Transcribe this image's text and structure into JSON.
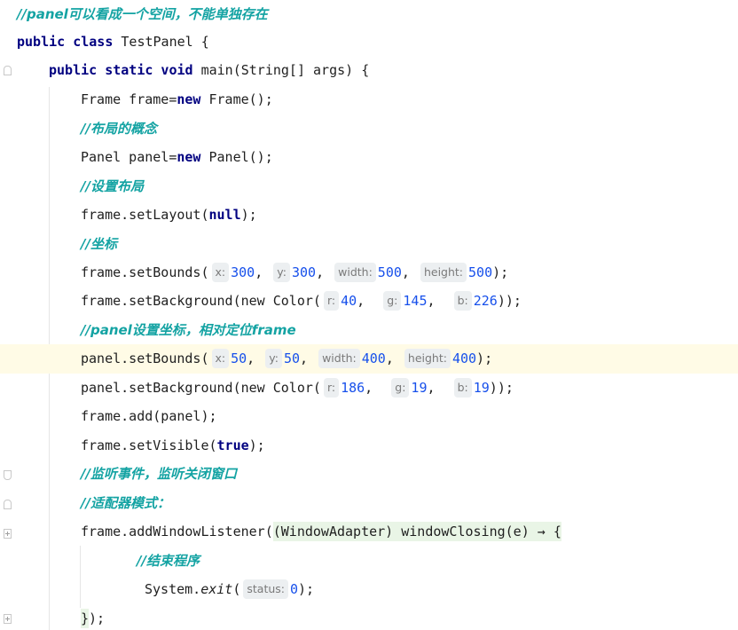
{
  "editor": {
    "lines": [
      {
        "segments": [
          {
            "t": "cmt",
            "v": "//panel可以看成一个空间，不能单独存在"
          }
        ]
      },
      {
        "segments": [
          {
            "t": "kw",
            "v": "public class "
          },
          {
            "t": "plain",
            "v": "TestPanel {"
          }
        ]
      },
      {
        "segments": [
          {
            "t": "kw",
            "v": "public static void "
          },
          {
            "t": "plain",
            "v": "main(String[] args) {"
          }
        ]
      },
      {
        "segments": [
          {
            "t": "plain",
            "v": "Frame frame="
          },
          {
            "t": "kw",
            "v": "new "
          },
          {
            "t": "plain",
            "v": "Frame();"
          }
        ]
      },
      {
        "segments": [
          {
            "t": "cmt",
            "v": "//布局的概念"
          }
        ]
      },
      {
        "segments": [
          {
            "t": "plain",
            "v": "Panel panel="
          },
          {
            "t": "kw",
            "v": "new "
          },
          {
            "t": "plain",
            "v": "Panel();"
          }
        ]
      },
      {
        "segments": [
          {
            "t": "cmt",
            "v": "//设置布局"
          }
        ]
      },
      {
        "segments": [
          {
            "t": "plain",
            "v": "frame.setLayout("
          },
          {
            "t": "kw",
            "v": "null"
          },
          {
            "t": "plain",
            "v": ");"
          }
        ]
      },
      {
        "segments": [
          {
            "t": "cmt",
            "v": "//坐标"
          }
        ]
      },
      {
        "segments": [
          {
            "t": "plain",
            "v": "frame.setBounds("
          },
          {
            "t": "hint",
            "v": "x:"
          },
          {
            "t": "num",
            "v": "300"
          },
          {
            "t": "plain",
            "v": ", "
          },
          {
            "t": "hint",
            "v": "y:"
          },
          {
            "t": "num",
            "v": "300"
          },
          {
            "t": "plain",
            "v": ", "
          },
          {
            "t": "hint",
            "v": "width:"
          },
          {
            "t": "num",
            "v": "500"
          },
          {
            "t": "plain",
            "v": ", "
          },
          {
            "t": "hint",
            "v": "height:"
          },
          {
            "t": "num",
            "v": "500"
          },
          {
            "t": "plain",
            "v": ");"
          }
        ]
      },
      {
        "segments": [
          {
            "t": "plain",
            "v": "frame.setBackground("
          },
          {
            "t": "kw-plain",
            "v": "new "
          },
          {
            "t": "plain",
            "v": "Color("
          },
          {
            "t": "hint",
            "v": "r:"
          },
          {
            "t": "num",
            "v": "40"
          },
          {
            "t": "plain",
            "v": ",  "
          },
          {
            "t": "hint",
            "v": "g:"
          },
          {
            "t": "num",
            "v": "145"
          },
          {
            "t": "plain",
            "v": ",  "
          },
          {
            "t": "hint",
            "v": "b:"
          },
          {
            "t": "num",
            "v": "226"
          },
          {
            "t": "plain",
            "v": "));"
          }
        ]
      },
      {
        "segments": [
          {
            "t": "cmt",
            "v": "//panel设置坐标，相对定位frame"
          }
        ]
      },
      {
        "segments": [
          {
            "t": "plain",
            "v": "panel.setBounds("
          },
          {
            "t": "hint",
            "v": "x:"
          },
          {
            "t": "num",
            "v": "50"
          },
          {
            "t": "plain",
            "v": ", "
          },
          {
            "t": "hint",
            "v": "y:"
          },
          {
            "t": "num",
            "v": "50"
          },
          {
            "t": "plain",
            "v": ", "
          },
          {
            "t": "hint",
            "v": "width:"
          },
          {
            "t": "num",
            "v": "400"
          },
          {
            "t": "plain",
            "v": ", "
          },
          {
            "t": "hint",
            "v": "height:"
          },
          {
            "t": "num",
            "v": "400"
          },
          {
            "t": "plain",
            "v": ");"
          }
        ]
      },
      {
        "segments": [
          {
            "t": "plain",
            "v": "panel.setBackground("
          },
          {
            "t": "kw-plain",
            "v": "new "
          },
          {
            "t": "plain",
            "v": "Color("
          },
          {
            "t": "hint",
            "v": "r:"
          },
          {
            "t": "num",
            "v": "186"
          },
          {
            "t": "plain",
            "v": ",  "
          },
          {
            "t": "hint",
            "v": "g:"
          },
          {
            "t": "num",
            "v": "19"
          },
          {
            "t": "plain",
            "v": ",  "
          },
          {
            "t": "hint",
            "v": "b:"
          },
          {
            "t": "num",
            "v": "19"
          },
          {
            "t": "plain",
            "v": "));"
          }
        ]
      },
      {
        "segments": [
          {
            "t": "plain",
            "v": "frame.add(panel);"
          }
        ]
      },
      {
        "segments": [
          {
            "t": "plain",
            "v": "frame.setVisible("
          },
          {
            "t": "kw",
            "v": "true"
          },
          {
            "t": "plain",
            "v": ");"
          }
        ]
      },
      {
        "segments": [
          {
            "t": "cmt",
            "v": "//监听事件，监听关闭窗口"
          }
        ]
      },
      {
        "segments": [
          {
            "t": "cmt",
            "v": "//适配器模式："
          }
        ]
      },
      {
        "segments": [
          {
            "t": "plain",
            "v": "frame.addWindowListener("
          },
          {
            "t": "lambda",
            "v": "(WindowAdapter) windowClosing(e) → {"
          }
        ]
      },
      {
        "segments": [
          {
            "t": "cmt",
            "v": "//结束程序"
          }
        ]
      },
      {
        "segments": [
          {
            "t": "plain",
            "v": "System."
          },
          {
            "t": "ital",
            "v": "exit"
          },
          {
            "t": "plain",
            "v": "("
          },
          {
            "t": "hint",
            "v": "status:"
          },
          {
            "t": "num",
            "v": "0"
          },
          {
            "t": "plain",
            "v": ");"
          }
        ]
      },
      {
        "segments": [
          {
            "t": "lambda",
            "v": "}"
          },
          {
            "t": "plain",
            "v": ");"
          }
        ]
      }
    ],
    "colors": {
      "keyword": "#000080",
      "number": "#1750eb",
      "comment": "#14a3a3",
      "active_line": "#fffbe6",
      "hint_bg": "#eceff1",
      "lambda_bg": "#e9f5e6"
    }
  }
}
